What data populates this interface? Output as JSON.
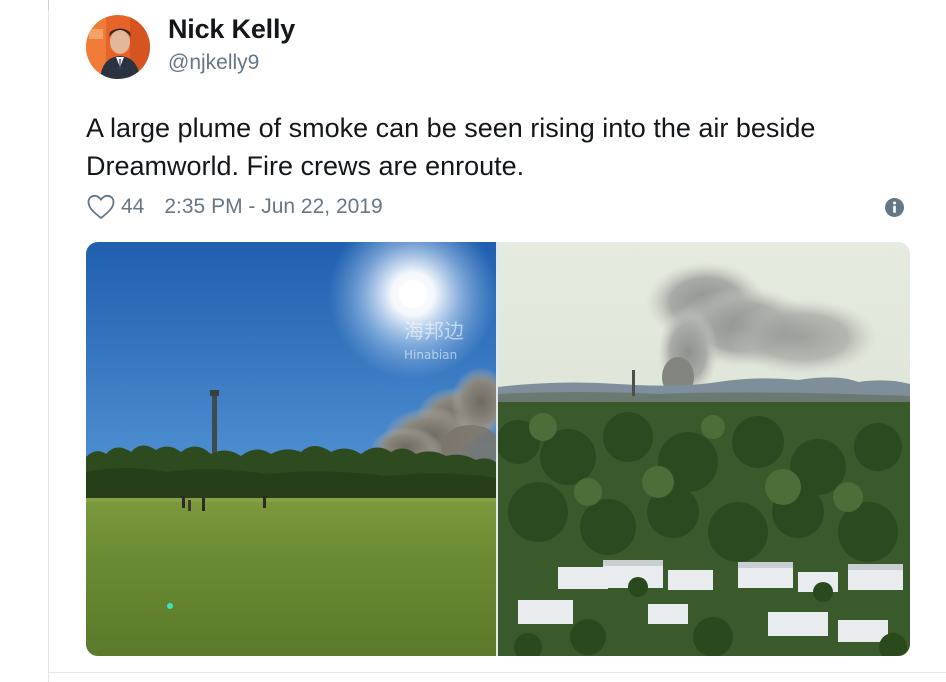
{
  "tweet": {
    "author_name": "Nick Kelly",
    "author_handle": "@njkelly9",
    "text_lines": [
      "A large plume of smoke can be seen rising into the air beside",
      "Dreamworld. Fire crews are enroute."
    ],
    "like_count": "44",
    "timestamp": "2:35 PM - Jun 22, 2019"
  },
  "icons": {
    "like": "heart-outline-icon",
    "info": "info-circle-icon"
  },
  "media": {
    "watermark_cn": "海邦边",
    "watermark_en": "Hinabian"
  },
  "colors": {
    "text_primary": "#14171a",
    "text_secondary": "#657786",
    "divider": "#e1e8ed"
  }
}
